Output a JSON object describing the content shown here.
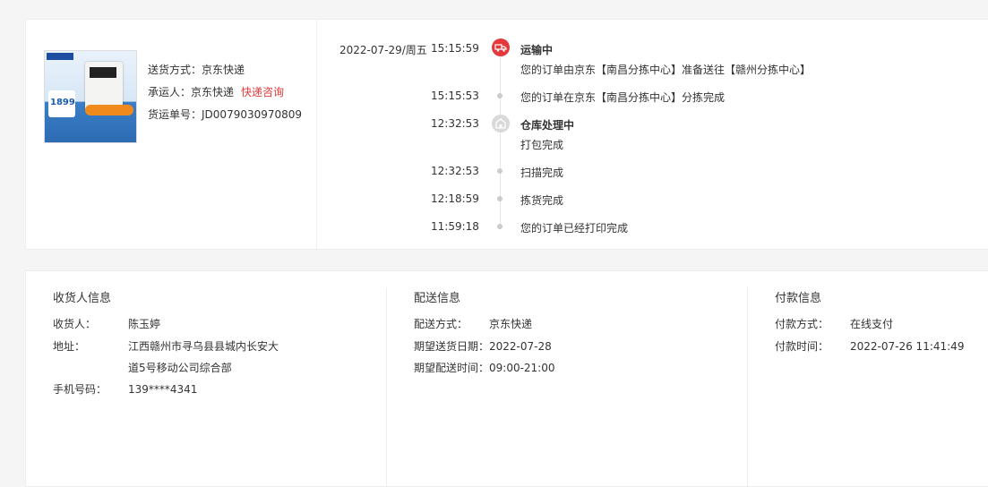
{
  "shipping": {
    "method_label": "送货方式：",
    "method_value": "京东快递",
    "carrier_label": "承运人：",
    "carrier_value": "京东快递",
    "consult_link": "快递咨询",
    "tracking_label": "货运单号：",
    "tracking_value": "JD0079030970809"
  },
  "product": {
    "price": "1899",
    "icon": "water-dispenser-product-image"
  },
  "timeline": {
    "date": "2022-07-29/周五",
    "events": [
      {
        "time": "15:15:59",
        "title": "运输中",
        "text": "您的订单由京东【南昌分拣中心】准备送往【赣州分拣中心】",
        "icon": "truck-icon"
      },
      {
        "time": "15:15:53",
        "title": "",
        "text": "您的订单在京东【南昌分拣中心】分拣完成"
      },
      {
        "time": "12:32:53",
        "title": "仓库处理中",
        "text": "打包完成",
        "icon": "warehouse-icon"
      },
      {
        "time": "12:32:53",
        "title": "",
        "text": "扫描完成"
      },
      {
        "time": "12:18:59",
        "title": "",
        "text": "拣货完成"
      },
      {
        "time": "11:59:18",
        "title": "",
        "text": "您的订单已经打印完成"
      }
    ]
  },
  "receiver": {
    "heading": "收货人信息",
    "name_label": "收货人：",
    "name_value": "陈玉婷",
    "address_label": "地址：",
    "address_line1": "江西赣州市寻乌县县城内长安大",
    "address_line2": "道5号移动公司综合部",
    "phone_label": "手机号码：",
    "phone_value": "139****4341"
  },
  "delivery": {
    "heading": "配送信息",
    "method_label": "配送方式：",
    "method_value": "京东快递",
    "date_label": "期望送货日期：",
    "date_value": "2022-07-28",
    "time_label": "期望配送时间：",
    "time_value": "09:00-21:00"
  },
  "payment": {
    "heading": "付款信息",
    "method_label": "付款方式：",
    "method_value": "在线支付",
    "time_label": "付款时间：",
    "time_value": "2022-07-26 11:41:49"
  },
  "colors": {
    "accent": "#e4393c",
    "text": "#333333",
    "border": "#eeeeee",
    "background": "#f5f5f5"
  }
}
